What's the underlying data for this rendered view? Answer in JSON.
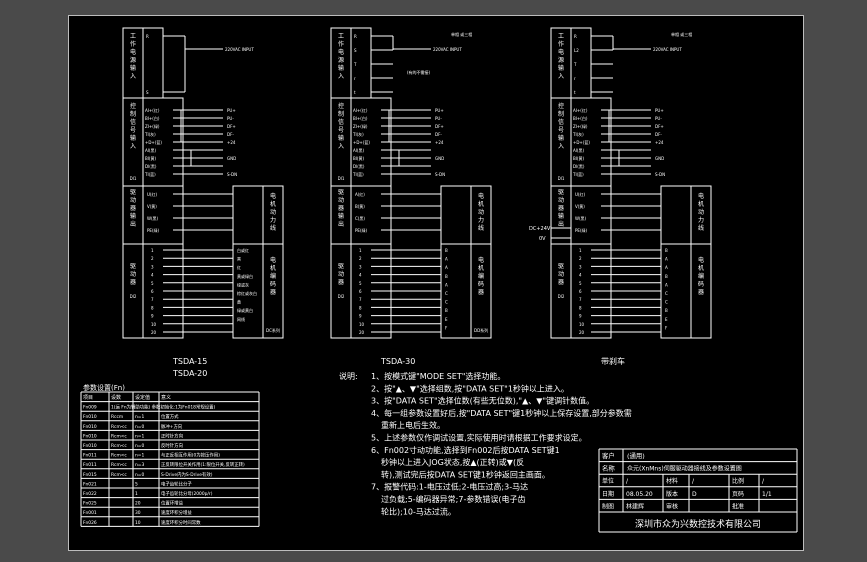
{
  "panels": [
    {
      "title": "TSDA-15",
      "title2": "TSDA-20",
      "supply_label": "220VAC INPUT",
      "supply_terms": [
        "R",
        "S"
      ],
      "enc_terms": [
        "AI+(红)",
        "BI+(白)",
        "ZI+(绿)",
        "TI(灰)",
        "+D+(蓝)",
        "AI(黑)",
        "BI(黄)",
        "DI(黑)",
        "TI(蓝)"
      ],
      "enc_signals": [
        "PU+",
        "PU-",
        "DF+",
        "DF-",
        "+24",
        "GND",
        "S-DN"
      ],
      "motor_terms": [
        "U(红)",
        "V(黄)",
        "W(黑)",
        "PE(绿)"
      ],
      "motor_out": [
        "U(红)",
        "V(黄)",
        "W(黑)"
      ],
      "motor_label": "电机动力线",
      "d12_terms": [
        "1",
        "2",
        "3",
        "4",
        "5",
        "6",
        "7",
        "8",
        "9",
        "10",
        "20"
      ],
      "d12_wires": [
        "白或红",
        "黑",
        "红",
        "黄或绿白",
        "绿或灰",
        "棕红或灰白",
        "黄",
        "绿或黄白",
        "网线"
      ],
      "d12_label": "电机编码器",
      "d12_side": "DC系列"
    },
    {
      "title": "TSDA-30",
      "supply_label": "220VAC INPUT",
      "supply_label2": "单相 或三相",
      "supply_label3": "(有的不需接)",
      "supply_terms": [
        "R",
        "S",
        "T",
        "r",
        "t"
      ],
      "enc_terms": [
        "AI+(红)",
        "BI+(白)",
        "ZI+(绿)",
        "TI(灰)",
        "+D+(蓝)",
        "AI(黑)",
        "BI(黄)",
        "DI(黑)",
        "TI(蓝)"
      ],
      "enc_signals": [
        "PU+",
        "PU-",
        "DF+",
        "DF-",
        "+24",
        "GND",
        "S-DN"
      ],
      "motor_terms": [
        "A(红)",
        "B(黄)",
        "C(黑)",
        "PE(绿)"
      ],
      "motor_label": "电机动力线",
      "d12_terms": [
        "1",
        "2",
        "3",
        "4",
        "5",
        "6",
        "7",
        "8",
        "9",
        "10",
        "20"
      ],
      "d12_wires": [
        "B",
        "A",
        "A",
        "B",
        "A",
        "C",
        "C",
        "B",
        "E",
        "F"
      ],
      "d12_label": "电机编码器",
      "d12_side": "DD系列"
    },
    {
      "title": "带刹车",
      "supply_label": "220VAC INPUT",
      "supply_label2": "单相 或三相",
      "supply_terms": [
        "R",
        "L2",
        "T",
        "r",
        "t"
      ],
      "enc_terms": [
        "AI+(红)",
        "BI+(白)",
        "ZI+(绿)",
        "TI(灰)",
        "+D+(蓝)",
        "AI(黑)",
        "BI(黄)",
        "DI(黑)",
        "TI(蓝)"
      ],
      "enc_signals": [
        "PU+",
        "PU-",
        "DF+",
        "DF-",
        "+24",
        "GND",
        "S-DN"
      ],
      "motor_terms": [
        "U(红)",
        "V(黄)",
        "W(黑)",
        "PE(绿)"
      ],
      "motor_label": "电机动力线",
      "brake_label": "DC+24V",
      "brake_label2": "0V",
      "d12_terms": [
        "1",
        "2",
        "3",
        "4",
        "5",
        "6",
        "7",
        "8",
        "9",
        "10",
        "20"
      ],
      "d12_wires": [
        "B",
        "A",
        "A",
        "B",
        "A",
        "C",
        "C",
        "B",
        "E",
        "F"
      ],
      "d12_label": "电机编码器"
    }
  ],
  "side_labels": {
    "power": "工作电源输入",
    "control": "控制信号输入",
    "control_code": "DI1",
    "motor": "驱动器输出",
    "encoder": "驱动器",
    "encoder_code": "DI2"
  },
  "params": {
    "title": "参数设置(Fn)",
    "headers": [
      "项目",
      "设数",
      "设定值",
      "意义"
    ],
    "rows": [
      [
        "Fn009",
        "1(运 Fn为辅助功能) 参数初始化:1为Fn018常规设置)",
        "",
        ""
      ],
      [
        "Fn010",
        "Rccm",
        "n=1",
        "位置方式"
      ],
      [
        "Fn010",
        "Rcm<c",
        "n=0",
        "脉冲+方向"
      ],
      [
        "Fn010",
        "Rcm<c",
        "n=1",
        "正时针方向"
      ],
      [
        "Fn010",
        "Rcm<c",
        "n=0",
        "反时针方向"
      ],
      [
        "Fn011",
        "Rcm<c",
        "n=1",
        "与正反相互作用(0为按压作用)"
      ],
      [
        "Fn011",
        "Rcm<c",
        "n=3",
        "正反转限位开关作用(1:限位开关,反转正转)"
      ],
      [
        "Fn015",
        "Rcm<c",
        "n=0",
        "S-Drive内为S-Drive有效)"
      ],
      [
        "Fn021",
        "",
        "5",
        "电子齿轮比分子"
      ],
      [
        "Fn022",
        "",
        "1",
        "电子齿轮比分母(2000p/r)"
      ],
      [
        "Fn025",
        "",
        "20",
        "位置环增益"
      ],
      [
        "Fn001",
        "",
        "30",
        "速度环积分增益"
      ],
      [
        "Fn026",
        "",
        "10",
        "速度环积分时间常数"
      ]
    ]
  },
  "notes": {
    "heading": "说明:",
    "items": [
      "1、按模式键\"MODE SET\"选择功能。",
      "2、按\"▲、▼\"选择组数,按\"DATA SET\"1秒钟以上进入。",
      "3、按\"DATA SET\"选择位数(有些无位数),\"▲、▼\"键调针数值。",
      "4、每一组参数设置好后,按\"DATA SET\"键1秒钟以上保存设置,部分参数需",
      "重新上电后生效。",
      "5、上述参数仅作调试设置,实际使用时请根据工作要求设定。",
      "6、Fn002寸动功能,选择到Fn002后按DATA SET键1",
      "秒钟以上进入JOG状态,按▲(正转)或▼(反",
      "转),测试完后按DATA SET键1秒钟返回主画面。",
      "7、报警代码:1-电压过低;2-电压过高;3-马达",
      "过负载;5-编码器异常;7-参数错误(电子齿",
      "轮比);10-马达过流。"
    ]
  },
  "title_block": {
    "customer_label": "客户",
    "customer_value": "(通用)",
    "name_label": "名称",
    "name_value": "众元(XnMns)伺服驱动器接线及参数设置图",
    "row3": [
      "单位",
      "/",
      "材料",
      "/",
      "比例",
      "/"
    ],
    "row4": [
      "日期",
      "08.05.20",
      "版本",
      "D",
      "页码",
      "1/1"
    ],
    "row5": [
      "制图",
      "林建辉",
      "审核",
      "",
      "批准",
      ""
    ],
    "company": "深圳市众为兴数控技术有限公司"
  }
}
